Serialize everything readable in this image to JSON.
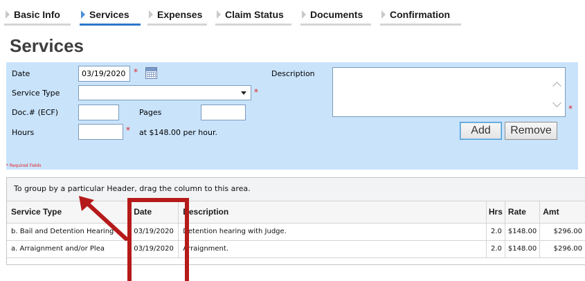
{
  "tabs": [
    {
      "label": "Basic Info",
      "active": false
    },
    {
      "label": "Services",
      "active": true
    },
    {
      "label": "Expenses",
      "active": false
    },
    {
      "label": "Claim Status",
      "active": false
    },
    {
      "label": "Documents",
      "active": false
    },
    {
      "label": "Confirmation",
      "active": false
    }
  ],
  "page": {
    "title": "Services"
  },
  "form": {
    "date_label": "Date",
    "date_value": "03/19/2020",
    "description_label": "Description",
    "service_type_label": "Service Type",
    "service_type_value": "",
    "doc_label": "Doc.# (ECF)",
    "doc_value": "",
    "pages_label": "Pages",
    "pages_value": "",
    "hours_label": "Hours",
    "hours_value": "",
    "rate_text": "at $148.00 per hour.",
    "required_marker": "*",
    "add_label": "Add",
    "remove_label": "Remove",
    "required_note": "* Required Fields"
  },
  "grid": {
    "group_hint": "To group by a particular Header, drag the column to this area.",
    "columns": [
      "Service Type",
      "Date",
      "Description",
      "Hrs",
      "Rate",
      "Amt"
    ],
    "rows": [
      {
        "service_type": "b. Bail and Detention Hearing",
        "date": "03/19/2020",
        "description": "Detention hearing with Judge.",
        "hrs": "2.0",
        "rate": "$148.00",
        "amt": "$296.00"
      },
      {
        "service_type": "a. Arraignment and/or Plea",
        "date": "03/19/2020",
        "description": "Arraignment.",
        "hrs": "2.0",
        "rate": "$148.00",
        "amt": "$296.00"
      }
    ]
  },
  "colors": {
    "panel_bg": "#c9e3fb",
    "active_tab": "#2b77c8",
    "annotation": "#b51a1a",
    "required": "#e02020"
  }
}
